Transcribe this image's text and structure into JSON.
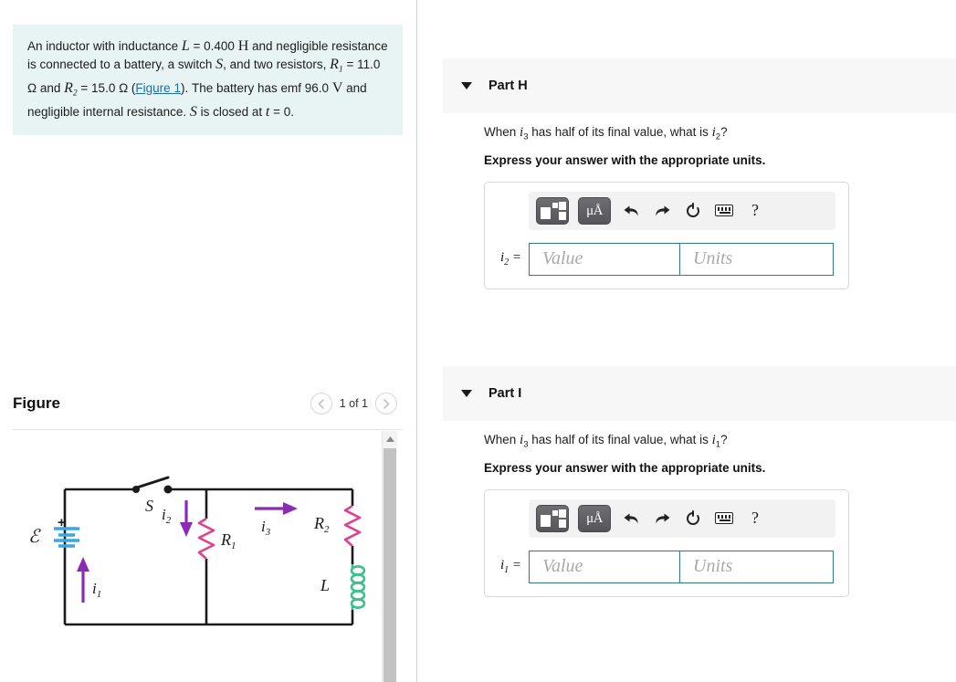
{
  "problem": {
    "text_segments": [
      {
        "t": "An inductor with inductance ",
        "k": "plain"
      },
      {
        "t": "L",
        "k": "var"
      },
      {
        "t": " = 0.400 ",
        "k": "plain"
      },
      {
        "t": "H",
        "k": "unit"
      },
      {
        "t": " and negligible resistance is connected to a battery, a switch ",
        "k": "plain"
      },
      {
        "t": "S",
        "k": "var"
      },
      {
        "t": ", and two resistors, ",
        "k": "plain"
      },
      {
        "t": "R1",
        "k": "var-sub"
      },
      {
        "t": " = 11.0 Ω and ",
        "k": "plain"
      },
      {
        "t": "R2",
        "k": "var-sub"
      },
      {
        "t": " = 15.0 Ω (",
        "k": "plain"
      },
      {
        "t": "Figure 1",
        "k": "link"
      },
      {
        "t": "). The battery has emf 96.0 ",
        "k": "plain"
      },
      {
        "t": "V",
        "k": "unit"
      },
      {
        "t": " and negligible internal resistance. ",
        "k": "plain"
      },
      {
        "t": "S",
        "k": "var"
      },
      {
        "t": " is closed at ",
        "k": "plain"
      },
      {
        "t": "t",
        "k": "var"
      },
      {
        "t": " = 0.",
        "k": "plain"
      }
    ],
    "inductance_label": "L",
    "inductance_value": "0.400",
    "inductance_unit": "H",
    "switch_label": "S",
    "r1_label": "R",
    "r1_value": "11.0 Ω",
    "r2_label": "R",
    "r2_value": "15.0 Ω",
    "figure_link": "Figure 1",
    "emf_value": "96.0",
    "emf_unit": "V",
    "time_label": "t = 0.",
    "background_color": "#e8f4f4"
  },
  "figure_panel": {
    "title": "Figure",
    "prev_label": "‹",
    "next_label": "›",
    "counter": "1 of 1",
    "prev_icon": "chevron-left-icon",
    "next_icon": "chevron-right-icon",
    "scroll_up_icon": "scroll-up-arrow-icon"
  },
  "circuit": {
    "emf_symbol": "ℰ",
    "plus_symbol": "+",
    "switch_label": "S",
    "current_1": "i",
    "current_1_sub": "1",
    "current_2": "i",
    "current_2_sub": "2",
    "current_3": "i",
    "current_3_sub": "3",
    "resistor_1": "R",
    "resistor_1_sub": "1",
    "resistor_2": "R",
    "resistor_2_sub": "2",
    "inductor": "L",
    "colors": {
      "wire": "#1a1a1a",
      "resistor": "#e0408c",
      "inductor": "#3cc08c",
      "battery": "#3aa7dd",
      "current_arrow": "#8b2bb5"
    }
  },
  "parts": [
    {
      "id": "part-h",
      "header": "Part H",
      "toggle_icon": "triangle-down-icon",
      "question_prefix": "When ",
      "question_var1": "i",
      "question_var1_sub": "3",
      "question_mid": " has half of its final value, what is ",
      "question_var2": "i",
      "question_var2_sub": "2",
      "question_suffix": "?",
      "instruction": "Express your answer with the appropriate units.",
      "answer_label_var": "i",
      "answer_label_sub": "2",
      "answer_label_eq": " =",
      "value_placeholder": "Value",
      "units_placeholder": "Units",
      "value_text": "",
      "units_text": "",
      "toolbar": {
        "template_icon": "math-template-icon",
        "units_icon": "micro-angstrom-units-icon",
        "units_icon_label": "μÅ",
        "undo_icon": "undo-arrow-icon",
        "redo_icon": "redo-arrow-icon",
        "reset_icon": "reset-circular-arrow-icon",
        "keyboard_icon": "keyboard-icon",
        "help_icon": "help-question-icon",
        "help_label": "?"
      }
    },
    {
      "id": "part-i",
      "header": "Part I",
      "toggle_icon": "triangle-down-icon",
      "question_prefix": "When ",
      "question_var1": "i",
      "question_var1_sub": "3",
      "question_mid": " has half of its final value, what is ",
      "question_var2": "i",
      "question_var2_sub": "1",
      "question_suffix": "?",
      "instruction": "Express your answer with the appropriate units.",
      "answer_label_var": "i",
      "answer_label_sub": "1",
      "answer_label_eq": " =",
      "value_placeholder": "Value",
      "units_placeholder": "Units",
      "value_text": "",
      "units_text": "",
      "toolbar": {
        "template_icon": "math-template-icon",
        "units_icon": "micro-angstrom-units-icon",
        "units_icon_label": "μÅ",
        "undo_icon": "undo-arrow-icon",
        "redo_icon": "redo-arrow-icon",
        "reset_icon": "reset-circular-arrow-icon",
        "keyboard_icon": "keyboard-icon",
        "help_icon": "help-question-icon",
        "help_label": "?"
      }
    }
  ],
  "theme": {
    "accent_input_border": "#2f7d84",
    "header_band": "#f7f7f7",
    "problem_bg": "#e8f4f4",
    "link_color": "#1a6ea8"
  }
}
